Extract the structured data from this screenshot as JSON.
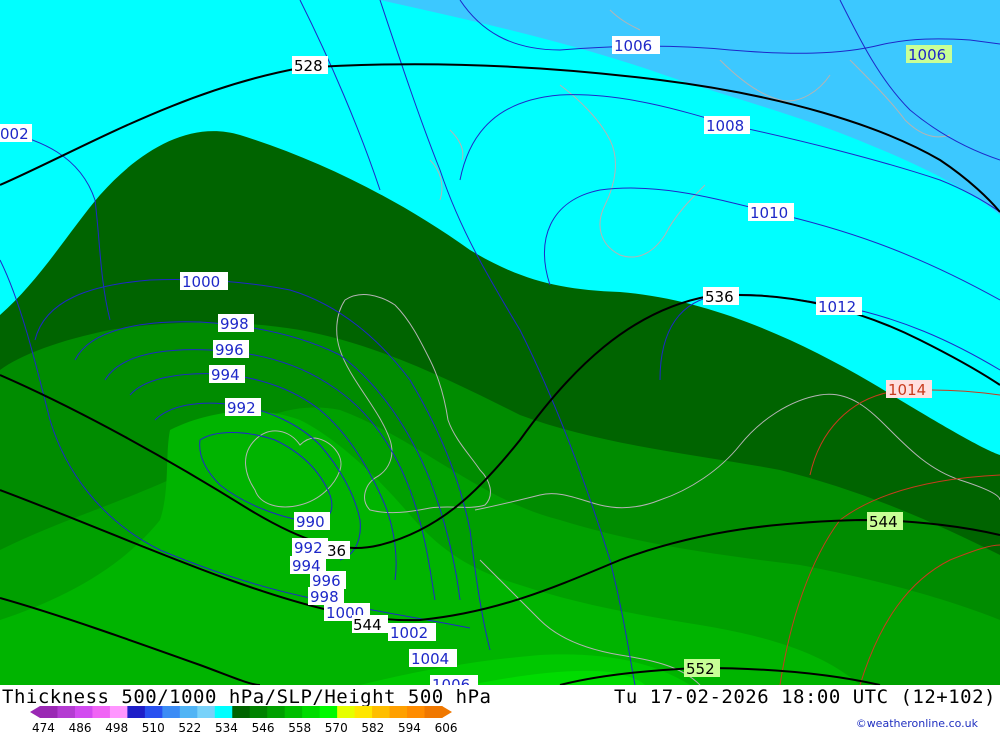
{
  "title": {
    "left": "Thickness 500/1000 hPa/SLP/Height 500 hPa",
    "right": "Tu 17-02-2026 18:00 UTC (12+102)"
  },
  "credit": "©weatheronline.co.uk",
  "colorbar": {
    "labels": [
      "474",
      "486",
      "498",
      "510",
      "522",
      "534",
      "546",
      "558",
      "570",
      "582",
      "594",
      "606"
    ],
    "colors": [
      "#9a28b4",
      "#b43cd2",
      "#d24bf0",
      "#f064f5",
      "#ff96ff",
      "#1e1ec8",
      "#2850f0",
      "#3c8cf5",
      "#50b4f5",
      "#78d2fa",
      "#00ffff",
      "#006400",
      "#008200",
      "#00a000",
      "#00be00",
      "#00dc00",
      "#00fa00",
      "#e6ff00",
      "#ffe600",
      "#ffbe00",
      "#ffa000",
      "#ff8c00",
      "#f07800"
    ]
  },
  "map": {
    "thickness_fill_colors": [
      "#3cc8ff",
      "#00ffff",
      "#006400",
      "#008c00",
      "#00a000",
      "#00b400",
      "#00c800",
      "#00dc00"
    ],
    "slp_isobar_color": "#1e28c8",
    "height_contour_color": "#000000",
    "coastline_color": "#b4b4b4",
    "slp_labels": [
      "1006",
      "1006",
      "002",
      "1008",
      "1010",
      "1012",
      "1014",
      "1000",
      "998",
      "996",
      "994",
      "992",
      "990",
      "992",
      "994",
      "996",
      "998",
      "1000",
      "1002",
      "1004",
      "1006"
    ],
    "height_labels": [
      "528",
      "536",
      "544",
      "36",
      "544",
      "552"
    ]
  }
}
